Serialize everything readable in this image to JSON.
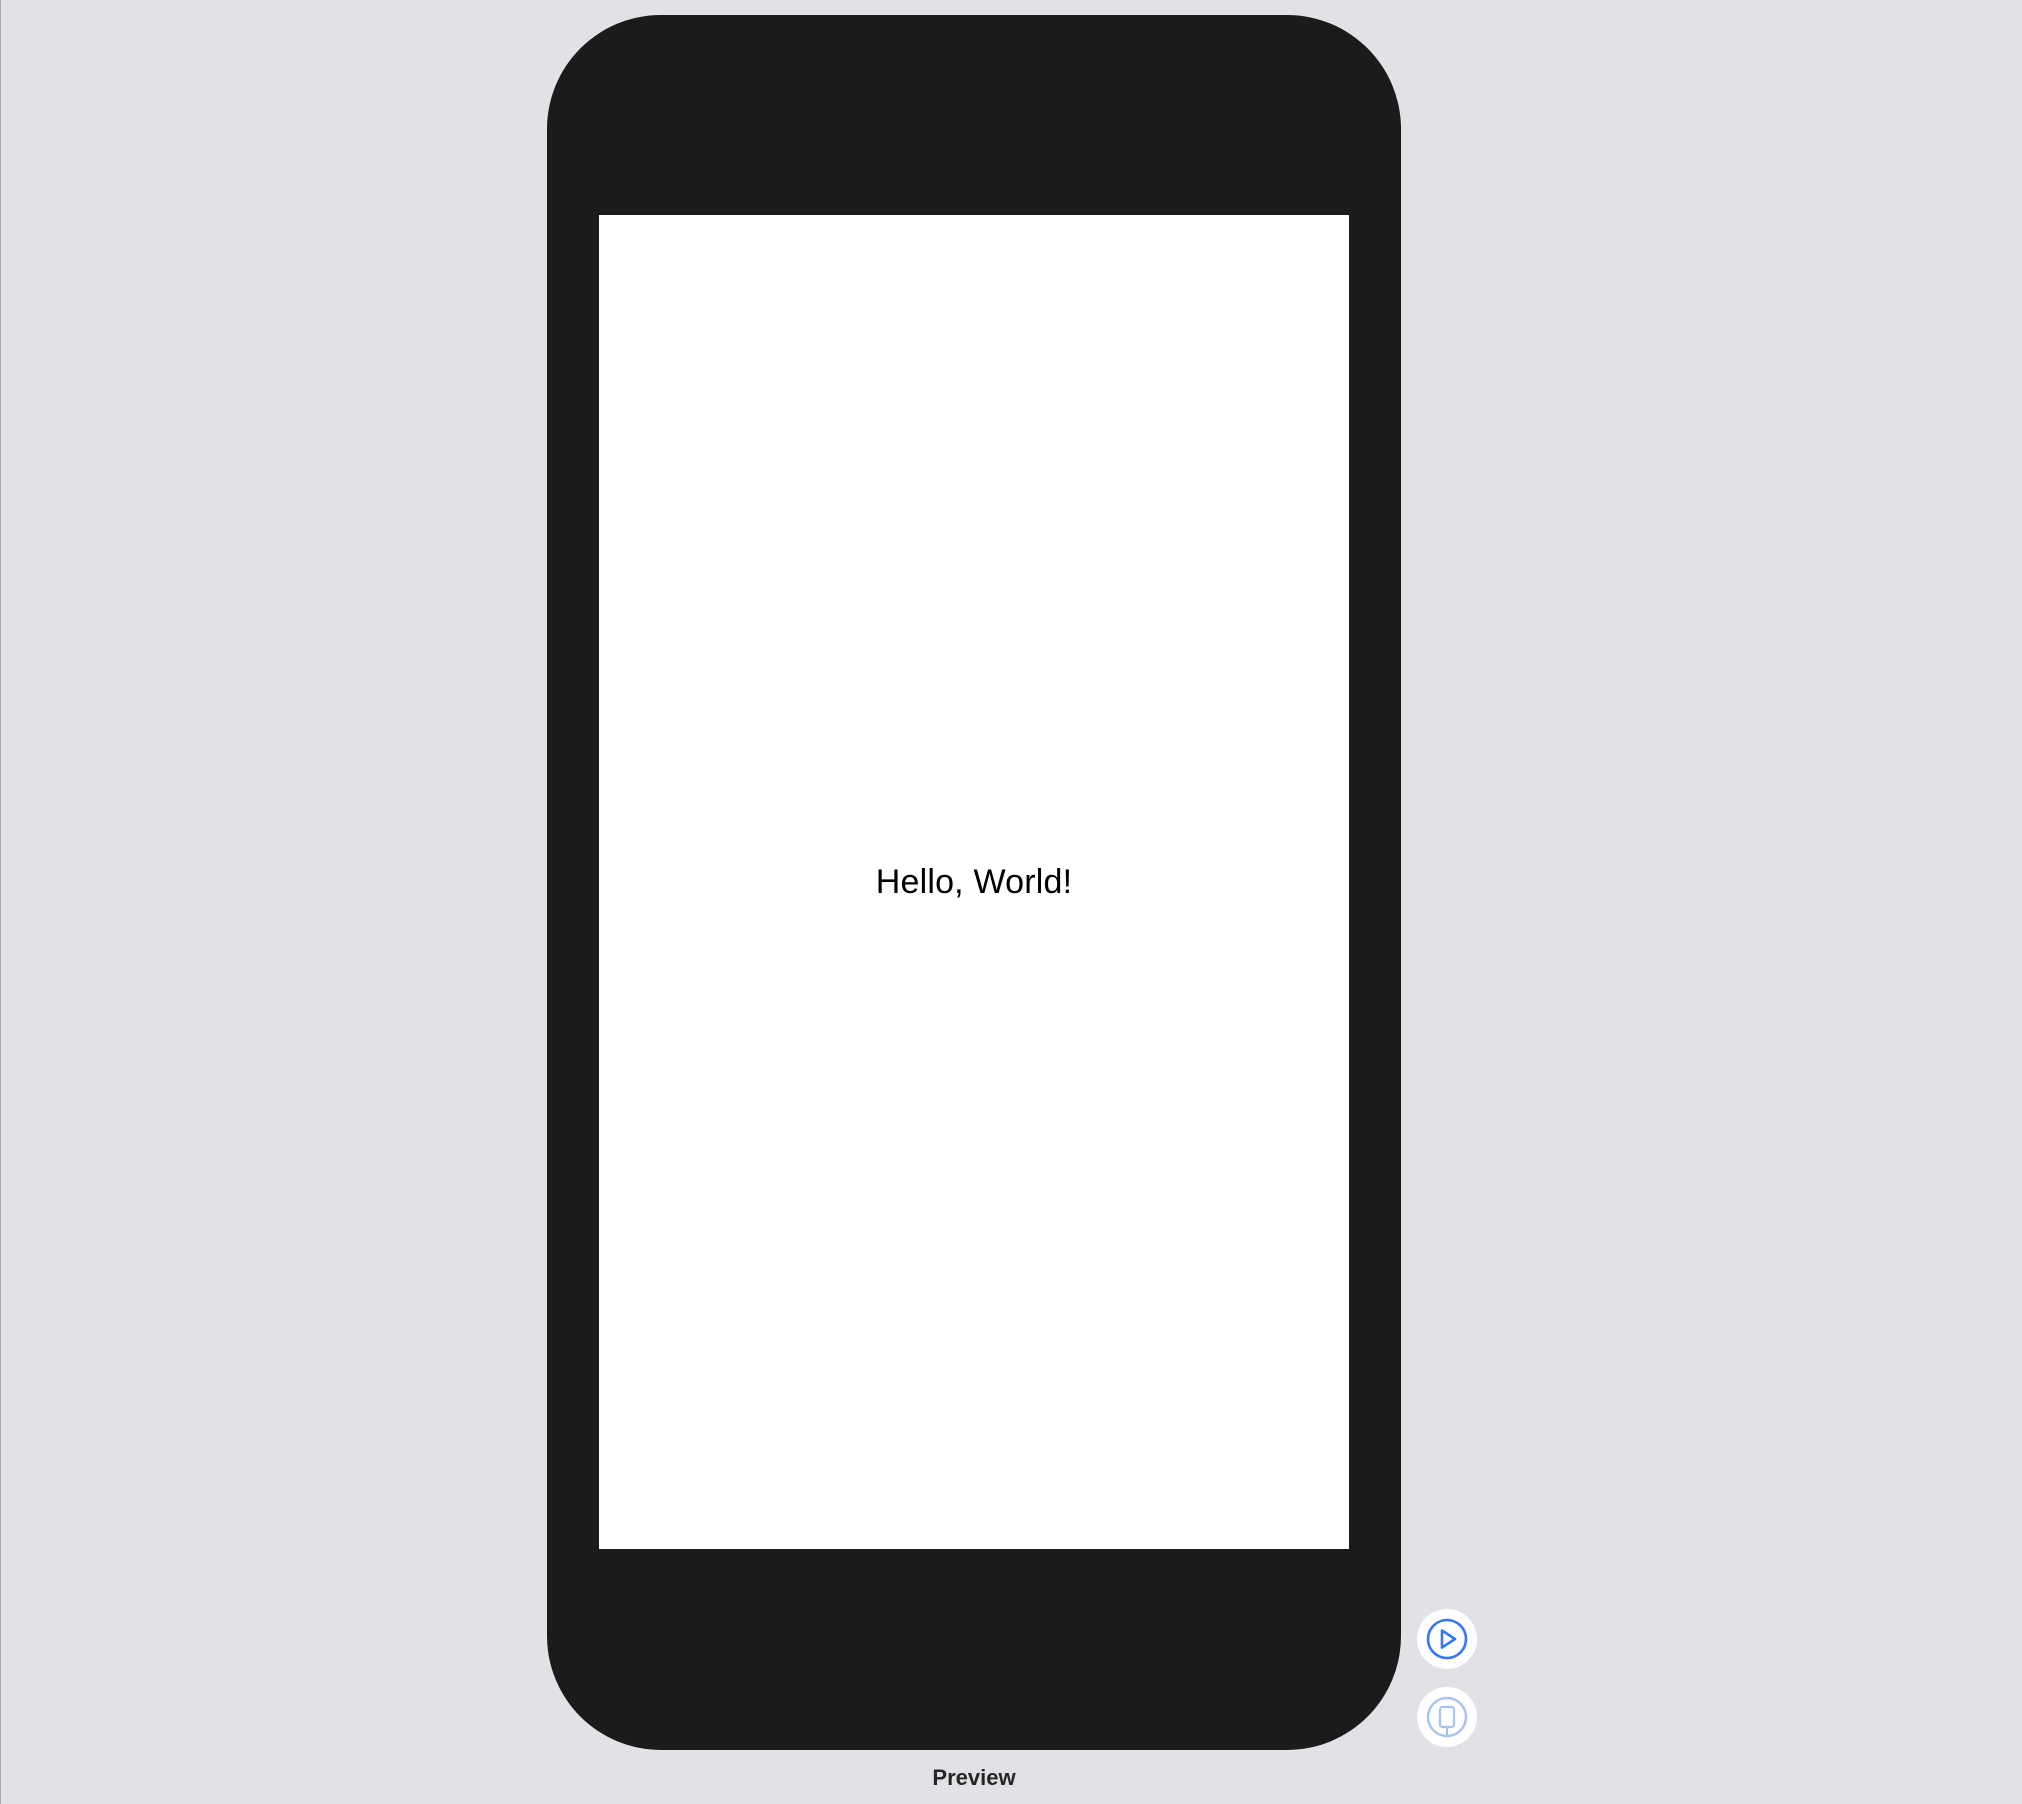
{
  "canvas": {
    "background_color": "#e1e2e5"
  },
  "device": {
    "bezel_color": "#1b1b1b",
    "screen_color": "#ffffff",
    "screen_text": "Hello, World!"
  },
  "controls": {
    "live_preview_icon": "play-circle-icon",
    "device_settings_icon": "device-icon",
    "accent_color": "#3478f6",
    "disabled_color": "#a9c3ef"
  },
  "footer": {
    "label": "Preview"
  }
}
